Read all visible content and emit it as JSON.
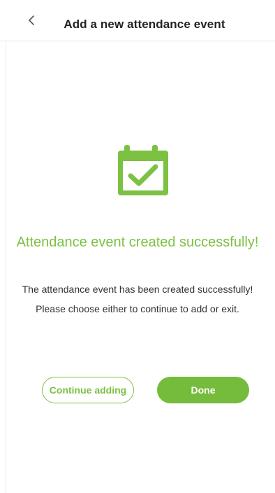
{
  "header": {
    "title": "Add a new attendance event",
    "back_icon": "chevron-left-icon"
  },
  "result": {
    "icon": "calendar-check-icon",
    "heading": "Attendance event created successfully!",
    "message_line1": "The attendance event has been created successfully!",
    "message_line2": "Please choose either to continue to add or exit."
  },
  "actions": {
    "continue_label": "Continue adding",
    "done_label": "Done"
  },
  "colors": {
    "accent": "#7cc142",
    "done_bg": "#76bc3c",
    "title_text": "#222222",
    "body_text": "#333333"
  }
}
